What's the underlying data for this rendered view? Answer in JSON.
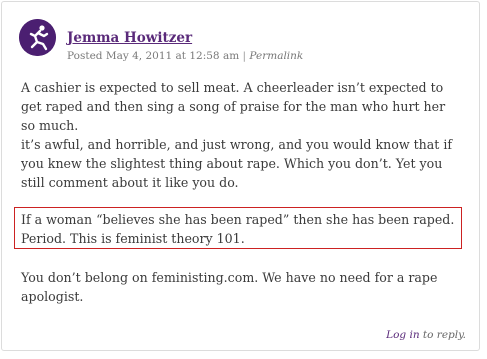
{
  "comment": {
    "author": "Jemma Howitzer",
    "posted_on": "Posted May 4, 2011 at 12:58 am",
    "separator": "|",
    "permalink": "Permalink",
    "paragraphs": [
      "A cashier is expected to sell meat. A cheerleader isn’t expected to get raped and then sing a song of praise for the man who hurt her so much.",
      "it’s awful, and horrible, and just wrong, and you would know that if you knew the slightest thing about rape. Which you don’t. Yet you still comment about it like you do.",
      "If a woman “believes she has been raped” then she has been raped. Period. This is feminist theory 101.",
      "You don’t belong on feministing.com. We have no need for a rape apologist."
    ],
    "reply_login": "Log in",
    "reply_rest": " to reply."
  },
  "colors": {
    "link_purple": "#5a2a7a",
    "avatar_bg": "#4b1f71",
    "highlight_border": "#cc2222"
  },
  "icons": {
    "avatar": "running-figure-avatar-icon"
  }
}
